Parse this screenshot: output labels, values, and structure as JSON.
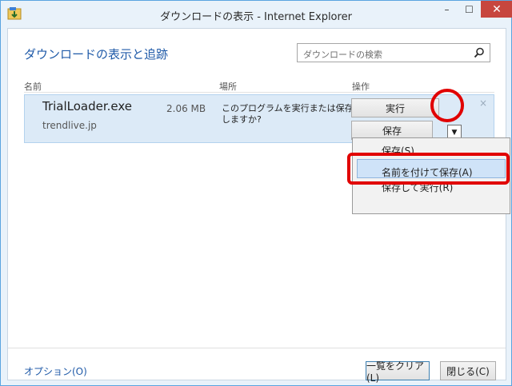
{
  "window": {
    "title": "ダウンロードの表示 - Internet Explorer",
    "minimize_glyph": "–",
    "maximize_glyph": "☐",
    "close_glyph": "✕"
  },
  "heading": "ダウンロードの表示と追跡",
  "search": {
    "placeholder": "ダウンロードの検索"
  },
  "columns": {
    "name": "名前",
    "location": "場所",
    "action": "操作"
  },
  "download": {
    "file_name": "TrialLoader.exe",
    "domain": "trendlive.jp",
    "size": "2.06 MB",
    "message": "このプログラムを実行または保存しますか?",
    "dismiss_glyph": "×",
    "run_label": "実行",
    "save_label": "保存",
    "dropdown_glyph": "▼"
  },
  "save_menu": {
    "items": [
      {
        "label": "保存(S)"
      },
      {
        "label": "名前を付けて保存(A)"
      },
      {
        "label": "保存して実行(R)"
      }
    ],
    "highlighted_index": 1
  },
  "footer": {
    "options_label": "オプション(O)",
    "clear_label": "一覧をクリア(L)",
    "close_label": "閉じる(C)"
  },
  "colors": {
    "accent": "#1f5aa8",
    "annotation_red": "#e10000",
    "row_highlight": "#dceaf7",
    "menu_highlight": "#cfe3f8"
  }
}
